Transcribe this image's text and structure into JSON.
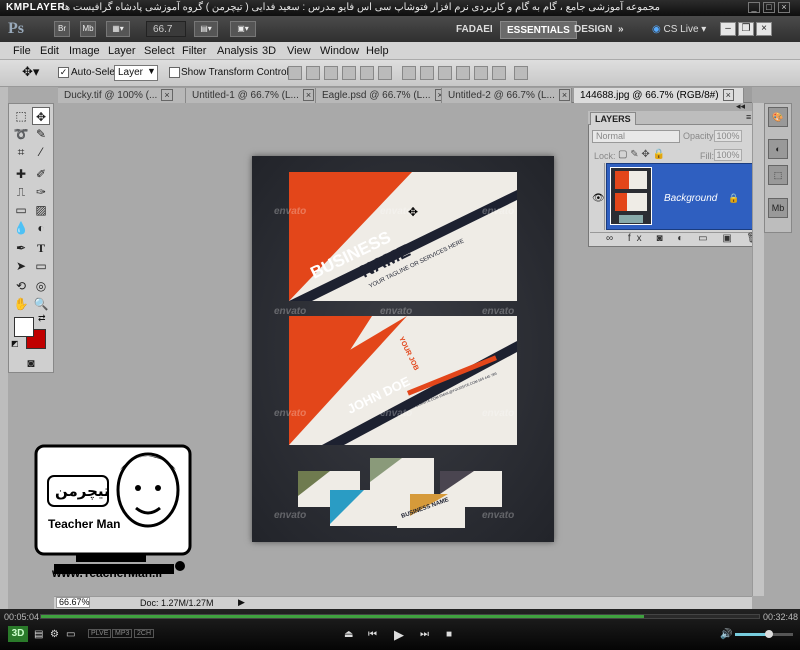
{
  "player": {
    "name": "KMPLAYER",
    "caption": "مجموعه آموزشی جامع ، گام به گام و کاربردی نرم افزار فتوشاپ سی اس فایو   مدرس : سعید فدایی ( تیچرمن ) گروه آموزشی پادشاه گرافیست ها",
    "elapsed": "00:05:04",
    "total": "00:32:48",
    "progress": 0.84,
    "volume": 0.55,
    "badges": [
      "PLVE",
      "MP3",
      "2CH"
    ]
  },
  "photoshop": {
    "logo": "Ps",
    "bridge": "Br",
    "minibridge": "Mb",
    "zoom_value": "66.7",
    "workspaces": [
      "FADAEI",
      "ESSENTIALS",
      "DESIGN"
    ],
    "cs_live": "CS Live",
    "menu": [
      "File",
      "Edit",
      "Image",
      "Layer",
      "Select",
      "Filter",
      "Analysis",
      "3D",
      "View",
      "Window",
      "Help"
    ],
    "options": {
      "auto_select_label": "Auto-Select:",
      "auto_select_value": "Layer",
      "show_transform": "Show Transform Controls"
    },
    "tabs": [
      {
        "label": "Ducky.tif @ 100% (...",
        "active": false
      },
      {
        "label": "Untitled-1 @ 66.7% (L...",
        "active": false
      },
      {
        "label": "Eagle.psd @ 66.7% (L...",
        "active": false
      },
      {
        "label": "Untitled-2 @ 66.7% (L...",
        "active": false
      },
      {
        "label": "144688.jpg @ 66.7% (RGB/8#)",
        "active": true
      }
    ],
    "layers_panel": {
      "title": "LAYERS",
      "blend_mode": "Normal",
      "opacity_label": "Opacity:",
      "opacity_value": "100%",
      "lock_label": "Lock:",
      "fill_label": "Fill:",
      "fill_value": "100%",
      "layer_name": "Background"
    },
    "status": {
      "zoom": "66.67%",
      "doc": "Doc: 1.27M/1.27M"
    },
    "colors": {
      "foreground": "#ffffff",
      "background": "#c00000"
    }
  },
  "artwork": {
    "watermark": "envato",
    "card1_title": "BUSINESS",
    "card1_name": "NAME",
    "card1_tagline": "YOUR TAGLINE OR SERVICES HERE",
    "card2_name": "JOHN DOE",
    "card2_job": "YOUR JOB",
    "card2_small": "WWW.YOURSITE.COM  EMAIL@YOURSITE.COM  555 445 789",
    "mini_title": "BUSINESS NAME",
    "accent": "#e3461a",
    "mini_colors": [
      "#6f7b4f",
      "#8a9a7a",
      "#4a4550",
      "#2a9cc4",
      "#d69a3a"
    ]
  },
  "branding": {
    "logo_text_fa": "تیچرمن",
    "logo_text_en": "Teacher Man",
    "url": "www.TeacherMan.ir"
  }
}
